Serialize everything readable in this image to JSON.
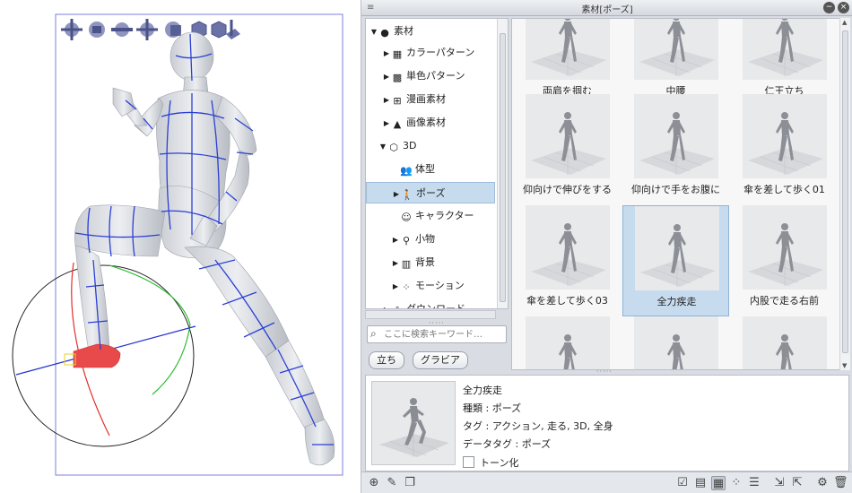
{
  "panel": {
    "title": "素材[ポーズ]",
    "menu_icon": "menu-icon",
    "minimize_label": "−",
    "close_label": "×"
  },
  "tree": {
    "items": [
      {
        "label": "素材",
        "expander": "▼",
        "icon": "●"
      },
      {
        "label": "カラーパターン",
        "expander": "▶",
        "icon": "▦"
      },
      {
        "label": "単色パターン",
        "expander": "▶",
        "icon": "▩"
      },
      {
        "label": "漫画素材",
        "expander": "▶",
        "icon": "⊞"
      },
      {
        "label": "画像素材",
        "expander": "▶",
        "icon": "▲"
      },
      {
        "label": "3D",
        "expander": "▼",
        "icon": "⬡"
      },
      {
        "label": "体型",
        "expander": "",
        "icon": "👥"
      },
      {
        "label": "ポーズ",
        "expander": "▶",
        "icon": "🚶"
      },
      {
        "label": "キャラクター",
        "expander": "",
        "icon": "☺"
      },
      {
        "label": "小物",
        "expander": "▶",
        "icon": "⚲"
      },
      {
        "label": "背景",
        "expander": "▶",
        "icon": "▥"
      },
      {
        "label": "モーション",
        "expander": "▶",
        "icon": "⁘"
      },
      {
        "label": "ダウンロード",
        "expander": "▶",
        "icon": "⇩"
      }
    ],
    "selected_index": 7
  },
  "search": {
    "placeholder": "ここに検索キーワード…"
  },
  "tags": [
    "立ち",
    "グラビア"
  ],
  "grid": {
    "items": [
      {
        "label": "両肩を掴む"
      },
      {
        "label": "中腰"
      },
      {
        "label": "仁王立ち"
      },
      {
        "label": "仰向けで伸びをする"
      },
      {
        "label": "仰向けで手をお腹に"
      },
      {
        "label": "傘を差して歩く01"
      },
      {
        "label": "傘を差して歩く03"
      },
      {
        "label": "全力疾走"
      },
      {
        "label": "内股で走る右前"
      },
      {
        "label": ""
      },
      {
        "label": ""
      },
      {
        "label": ""
      }
    ],
    "selected_index": 7
  },
  "detail": {
    "name": "全力疾走",
    "kind": "種類 : ポーズ",
    "tags": "タグ : アクション, 走る, 3D, 全身",
    "data_tags": "データタグ : ポーズ",
    "tone_label": "トーン化",
    "tone_checked": false
  },
  "toolbar_icons": {
    "left": [
      "new-folder-icon",
      "edit-icon",
      "duplicate-icon"
    ],
    "right": [
      "check-icon",
      "list-detail-icon",
      "large-thumb-icon",
      "small-thumb-icon",
      "list-icon",
      "import-icon",
      "export-icon",
      "settings-icon",
      "delete-icon"
    ]
  },
  "canvas": {
    "colors": {
      "mesh": "#2a3fd6",
      "selected_part": "#e8494a",
      "figure": "#d8dadf",
      "bbox": "#7b7fe0",
      "gizmo_red": "#e0302a",
      "gizmo_green": "#2fbf34",
      "gizmo_blue": "#2332d0"
    }
  }
}
